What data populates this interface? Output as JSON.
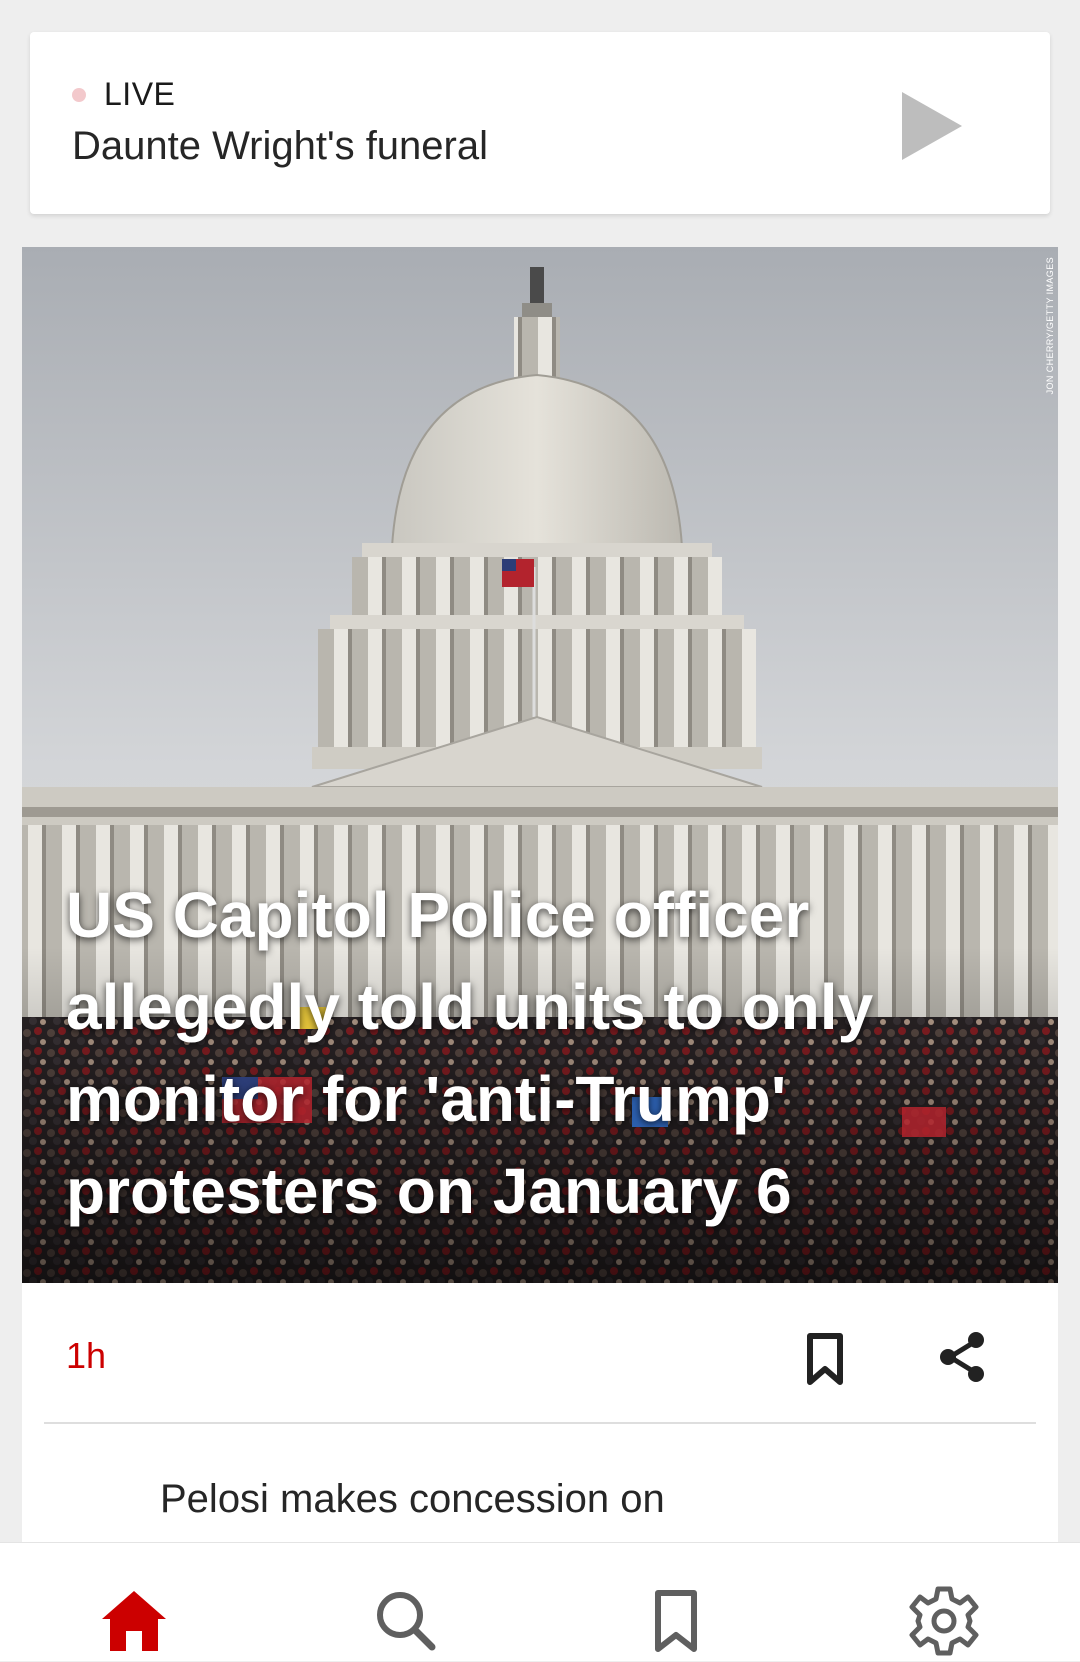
{
  "live": {
    "label": "LIVE",
    "title": "Daunte Wright's funeral",
    "play_icon": "play-icon",
    "dot_color": "#f3c9cc"
  },
  "story": {
    "photo_credit": "JON CHERRY/GETTY IMAGES",
    "headline": "US Capitol Police officer allegedly told units to only monitor for 'anti-Trump' protesters on January 6",
    "timestamp": "1h",
    "bookmark_icon": "bookmark-icon",
    "share_icon": "share-icon"
  },
  "next_story": {
    "title": "Pelosi makes concession on"
  },
  "nav": {
    "items": [
      {
        "name": "home",
        "icon": "home-icon",
        "active": true
      },
      {
        "name": "search",
        "icon": "search-icon",
        "active": false
      },
      {
        "name": "saved",
        "icon": "bookmark-icon",
        "active": false
      },
      {
        "name": "settings",
        "icon": "gear-icon",
        "active": false
      }
    ]
  },
  "colors": {
    "accent": "#cc0000",
    "text": "#262626",
    "background": "#eeeeee"
  }
}
